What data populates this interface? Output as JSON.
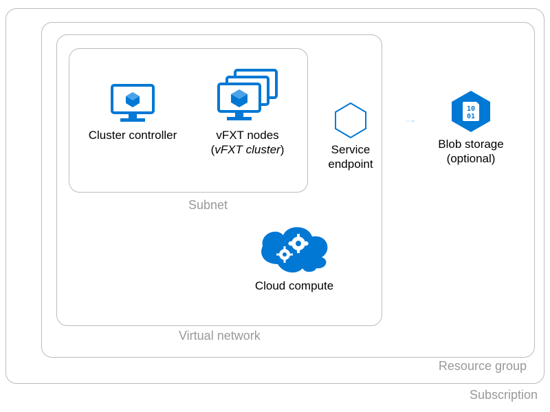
{
  "colors": {
    "azure_blue": "#0078D4",
    "box_border": "#bbbbbb",
    "label_grey": "#999999"
  },
  "boxes": {
    "subscription": "Subscription",
    "resource_group": "Resource group",
    "vnet": "Virtual network",
    "subnet": "Subnet"
  },
  "items": {
    "cluster_controller": {
      "label": "Cluster controller",
      "icon": "vm-icon"
    },
    "vfxt_nodes": {
      "label": "vFXT nodes",
      "sublabel_prefix": "(",
      "sublabel_italic": "vFXT cluster",
      "sublabel_suffix": ")",
      "icon": "vm-stack-icon"
    },
    "service_endpoint": {
      "label_line1": "Service",
      "label_line2": "endpoint",
      "icon": "hexagon-icon"
    },
    "blob_storage": {
      "label_line1": "Blob storage",
      "label_line2": "(optional)",
      "icon": "blob-icon"
    },
    "cloud_compute": {
      "label": "Cloud compute",
      "icon": "cloud-gears-icon"
    }
  }
}
